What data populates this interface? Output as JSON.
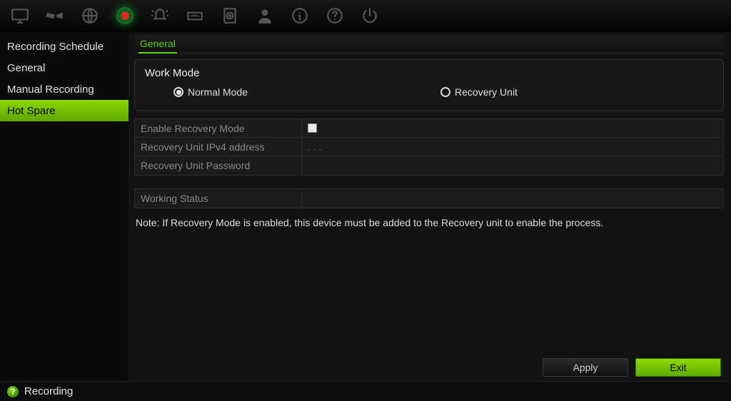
{
  "sidebar": {
    "items": [
      {
        "label": "Recording Schedule",
        "active": false
      },
      {
        "label": "General",
        "active": false
      },
      {
        "label": "Manual Recording",
        "active": false
      },
      {
        "label": "Hot Spare",
        "active": true
      }
    ]
  },
  "tabs": {
    "active": "General"
  },
  "work_mode": {
    "title": "Work Mode",
    "options": {
      "normal": "Normal Mode",
      "recovery": "Recovery Unit"
    },
    "selected": "normal"
  },
  "fields": {
    "enable_recovery": {
      "label": "Enable Recovery Mode",
      "checked": false
    },
    "ipv4": {
      "label": "Recovery Unit IPv4 address",
      "value": ".    .     ."
    },
    "password": {
      "label": "Recovery Unit Password",
      "value": ""
    },
    "working_status": {
      "label": "Working Status",
      "value": ""
    }
  },
  "note": "Note: If Recovery Mode is enabled, this device must be added to the Recovery unit to enable the process.",
  "buttons": {
    "apply": "Apply",
    "exit": "Exit"
  },
  "statusbar": {
    "label": "Recording"
  },
  "toolbar_icons": [
    "monitor-icon",
    "camera-icon",
    "globe-icon",
    "record-icon",
    "alarm-icon",
    "speed-icon",
    "disk-icon",
    "user-icon",
    "info-icon",
    "help-icon",
    "power-icon"
  ]
}
